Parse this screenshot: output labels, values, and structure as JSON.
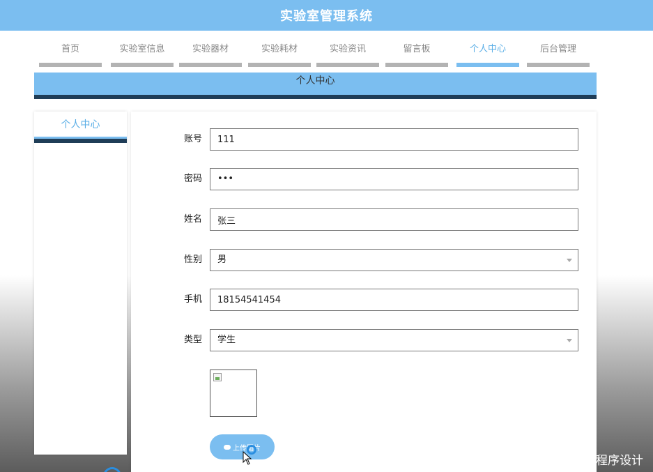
{
  "app": {
    "title": "实验室管理系统"
  },
  "nav": [
    {
      "label": "首页"
    },
    {
      "label": "实验室信息"
    },
    {
      "label": "实验器材"
    },
    {
      "label": "实验耗材"
    },
    {
      "label": "实验资讯"
    },
    {
      "label": "留言板"
    },
    {
      "label": "个人中心",
      "active": true
    },
    {
      "label": "后台管理"
    }
  ],
  "section": {
    "title": "个人中心"
  },
  "sidebar": {
    "items": [
      {
        "label": "个人中心",
        "active": true
      }
    ]
  },
  "form": {
    "account": {
      "label": "账号",
      "value": "111"
    },
    "password": {
      "label": "密码",
      "value": "•••"
    },
    "name": {
      "label": "姓名",
      "value": "张三"
    },
    "gender": {
      "label": "性别",
      "value": "男"
    },
    "phone": {
      "label": "手机",
      "value": "18154541454"
    },
    "type": {
      "label": "类型",
      "value": "学生"
    },
    "upload": {
      "label": "上传图片"
    }
  },
  "watermark": "CSDN @卓杰计算机程序设计",
  "colors": {
    "accent": "#7bbef0",
    "dark": "#1f3d57",
    "inactive_bar": "#b3b3b3",
    "ring": "#2a8ee0"
  }
}
